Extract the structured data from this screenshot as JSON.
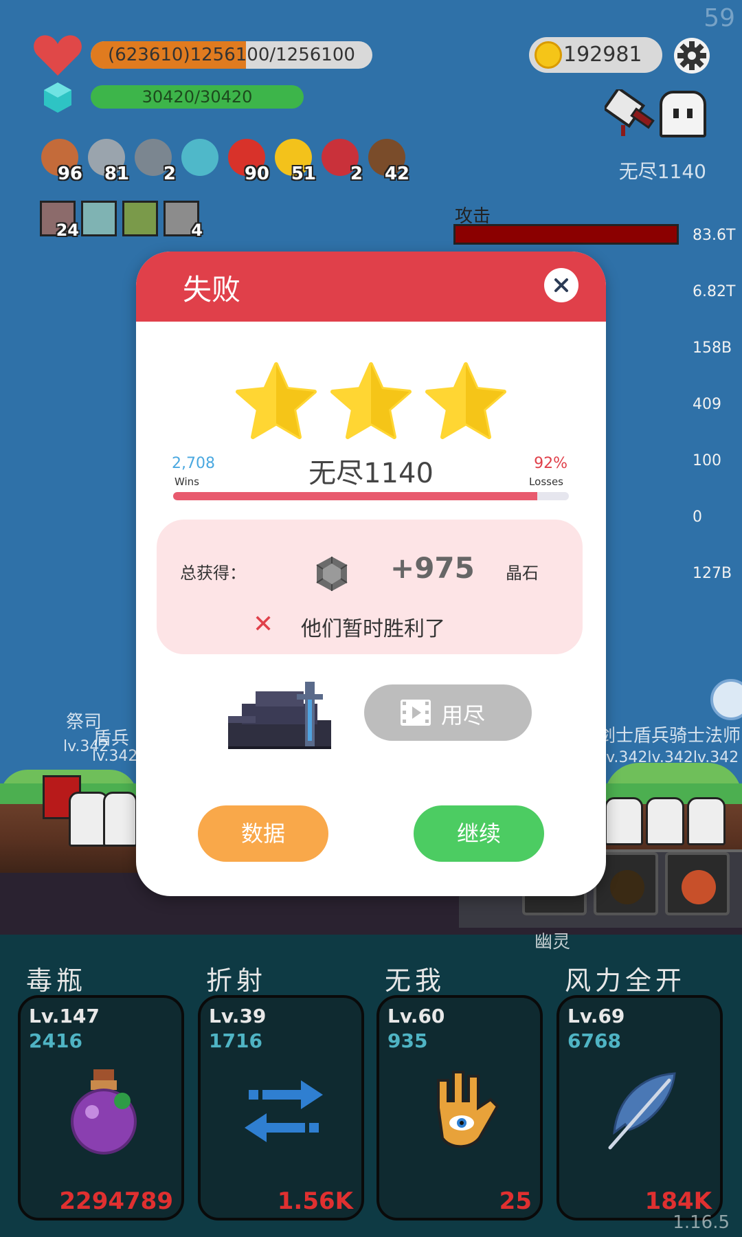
{
  "hud": {
    "fps": "59",
    "hp_text": "(623610)1256100/1256100",
    "hp_fraction": 0.55,
    "mp_text": "30420/30420",
    "coins": "192981",
    "stage_label": "无尽1140",
    "version": "1.16.5"
  },
  "items": [
    {
      "icon": "shield-icon",
      "count": "96",
      "color": "#c46b3a"
    },
    {
      "icon": "sword-icon",
      "count": "81",
      "color": "#9aa4ad"
    },
    {
      "icon": "mortar-icon",
      "count": "2",
      "color": "#7b8690"
    },
    {
      "icon": "magnifier-icon",
      "count": "",
      "color": "#4fb8c9"
    },
    {
      "icon": "apple-icon",
      "count": "90",
      "color": "#d8322a"
    },
    {
      "icon": "crown-icon",
      "count": "51",
      "color": "#f3c21b"
    },
    {
      "icon": "magnet-icon",
      "count": "2",
      "color": "#c9313a"
    },
    {
      "icon": "coconut-icon",
      "count": "42",
      "color": "#7a4c2a"
    }
  ],
  "buffs": [
    {
      "icon": "blade-buff-icon",
      "count": "24",
      "color": "#8c6b6b"
    },
    {
      "icon": "light-buff-icon",
      "count": "",
      "color": "#7fb3b3"
    },
    {
      "icon": "helmet-buff-icon",
      "count": "",
      "color": "#7a9a4a"
    },
    {
      "icon": "blade2-buff-icon",
      "count": "4",
      "color": "#8c8c8c"
    }
  ],
  "stats": {
    "attack_label": "攻击",
    "values": [
      "83.6T",
      "6.82T",
      "158B",
      "409",
      "100",
      "0",
      "127B"
    ]
  },
  "battlefield": {
    "left_labels": [
      "祭司",
      "盾兵",
      "lv.342",
      "lv.342"
    ],
    "right_label": "剑士盾兵骑士法师",
    "right_level": "lv.342lv.342lv.342",
    "ghost_label": "幽灵"
  },
  "dialog": {
    "title": "失败",
    "wins": "2,708",
    "wins_label": "Wins",
    "losses_pct": "92%",
    "losses_label": "Losses",
    "level_name": "无尽1140",
    "progress": 0.92,
    "total_label": "总获得：",
    "reward_value": "+975",
    "reward_unit": "晶石",
    "result_text": "他们暂时胜利了",
    "video_label": "用尽",
    "data_label": "数据",
    "continue_label": "继续"
  },
  "skills": [
    {
      "name": "毒瓶",
      "level": "Lv.147",
      "value": "2416",
      "cost": "2294789",
      "icon": "poison-bottle-icon"
    },
    {
      "name": "折射",
      "level": "Lv.39",
      "value": "1716",
      "cost": "1.56K",
      "icon": "refract-arrows-icon"
    },
    {
      "name": "无我",
      "level": "Lv.60",
      "value": "935",
      "cost": "25",
      "icon": "hamsa-hand-icon"
    },
    {
      "name": "风力全开",
      "level": "Lv.69",
      "value": "6768",
      "cost": "184K",
      "icon": "feather-icon"
    }
  ]
}
